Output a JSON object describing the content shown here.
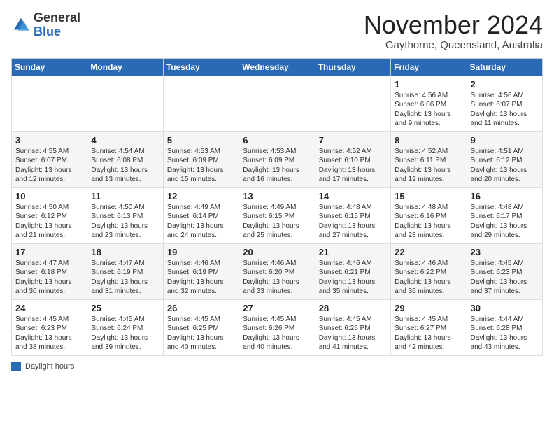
{
  "header": {
    "logo_general": "General",
    "logo_blue": "Blue",
    "month": "November 2024",
    "location": "Gaythorne, Queensland, Australia"
  },
  "weekdays": [
    "Sunday",
    "Monday",
    "Tuesday",
    "Wednesday",
    "Thursday",
    "Friday",
    "Saturday"
  ],
  "legend": {
    "label": "Daylight hours"
  },
  "weeks": [
    [
      {
        "day": "",
        "info": ""
      },
      {
        "day": "",
        "info": ""
      },
      {
        "day": "",
        "info": ""
      },
      {
        "day": "",
        "info": ""
      },
      {
        "day": "",
        "info": ""
      },
      {
        "day": "1",
        "info": "Sunrise: 4:56 AM\nSunset: 6:06 PM\nDaylight: 13 hours\nand 9 minutes."
      },
      {
        "day": "2",
        "info": "Sunrise: 4:56 AM\nSunset: 6:07 PM\nDaylight: 13 hours\nand 11 minutes."
      }
    ],
    [
      {
        "day": "3",
        "info": "Sunrise: 4:55 AM\nSunset: 6:07 PM\nDaylight: 13 hours\nand 12 minutes."
      },
      {
        "day": "4",
        "info": "Sunrise: 4:54 AM\nSunset: 6:08 PM\nDaylight: 13 hours\nand 13 minutes."
      },
      {
        "day": "5",
        "info": "Sunrise: 4:53 AM\nSunset: 6:09 PM\nDaylight: 13 hours\nand 15 minutes."
      },
      {
        "day": "6",
        "info": "Sunrise: 4:53 AM\nSunset: 6:09 PM\nDaylight: 13 hours\nand 16 minutes."
      },
      {
        "day": "7",
        "info": "Sunrise: 4:52 AM\nSunset: 6:10 PM\nDaylight: 13 hours\nand 17 minutes."
      },
      {
        "day": "8",
        "info": "Sunrise: 4:52 AM\nSunset: 6:11 PM\nDaylight: 13 hours\nand 19 minutes."
      },
      {
        "day": "9",
        "info": "Sunrise: 4:51 AM\nSunset: 6:12 PM\nDaylight: 13 hours\nand 20 minutes."
      }
    ],
    [
      {
        "day": "10",
        "info": "Sunrise: 4:50 AM\nSunset: 6:12 PM\nDaylight: 13 hours\nand 21 minutes."
      },
      {
        "day": "11",
        "info": "Sunrise: 4:50 AM\nSunset: 6:13 PM\nDaylight: 13 hours\nand 23 minutes."
      },
      {
        "day": "12",
        "info": "Sunrise: 4:49 AM\nSunset: 6:14 PM\nDaylight: 13 hours\nand 24 minutes."
      },
      {
        "day": "13",
        "info": "Sunrise: 4:49 AM\nSunset: 6:15 PM\nDaylight: 13 hours\nand 25 minutes."
      },
      {
        "day": "14",
        "info": "Sunrise: 4:48 AM\nSunset: 6:15 PM\nDaylight: 13 hours\nand 27 minutes."
      },
      {
        "day": "15",
        "info": "Sunrise: 4:48 AM\nSunset: 6:16 PM\nDaylight: 13 hours\nand 28 minutes."
      },
      {
        "day": "16",
        "info": "Sunrise: 4:48 AM\nSunset: 6:17 PM\nDaylight: 13 hours\nand 29 minutes."
      }
    ],
    [
      {
        "day": "17",
        "info": "Sunrise: 4:47 AM\nSunset: 6:18 PM\nDaylight: 13 hours\nand 30 minutes."
      },
      {
        "day": "18",
        "info": "Sunrise: 4:47 AM\nSunset: 6:19 PM\nDaylight: 13 hours\nand 31 minutes."
      },
      {
        "day": "19",
        "info": "Sunrise: 4:46 AM\nSunset: 6:19 PM\nDaylight: 13 hours\nand 32 minutes."
      },
      {
        "day": "20",
        "info": "Sunrise: 4:46 AM\nSunset: 6:20 PM\nDaylight: 13 hours\nand 33 minutes."
      },
      {
        "day": "21",
        "info": "Sunrise: 4:46 AM\nSunset: 6:21 PM\nDaylight: 13 hours\nand 35 minutes."
      },
      {
        "day": "22",
        "info": "Sunrise: 4:46 AM\nSunset: 6:22 PM\nDaylight: 13 hours\nand 36 minutes."
      },
      {
        "day": "23",
        "info": "Sunrise: 4:45 AM\nSunset: 6:23 PM\nDaylight: 13 hours\nand 37 minutes."
      }
    ],
    [
      {
        "day": "24",
        "info": "Sunrise: 4:45 AM\nSunset: 6:23 PM\nDaylight: 13 hours\nand 38 minutes."
      },
      {
        "day": "25",
        "info": "Sunrise: 4:45 AM\nSunset: 6:24 PM\nDaylight: 13 hours\nand 39 minutes."
      },
      {
        "day": "26",
        "info": "Sunrise: 4:45 AM\nSunset: 6:25 PM\nDaylight: 13 hours\nand 40 minutes."
      },
      {
        "day": "27",
        "info": "Sunrise: 4:45 AM\nSunset: 6:26 PM\nDaylight: 13 hours\nand 40 minutes."
      },
      {
        "day": "28",
        "info": "Sunrise: 4:45 AM\nSunset: 6:26 PM\nDaylight: 13 hours\nand 41 minutes."
      },
      {
        "day": "29",
        "info": "Sunrise: 4:45 AM\nSunset: 6:27 PM\nDaylight: 13 hours\nand 42 minutes."
      },
      {
        "day": "30",
        "info": "Sunrise: 4:44 AM\nSunset: 6:28 PM\nDaylight: 13 hours\nand 43 minutes."
      }
    ]
  ]
}
